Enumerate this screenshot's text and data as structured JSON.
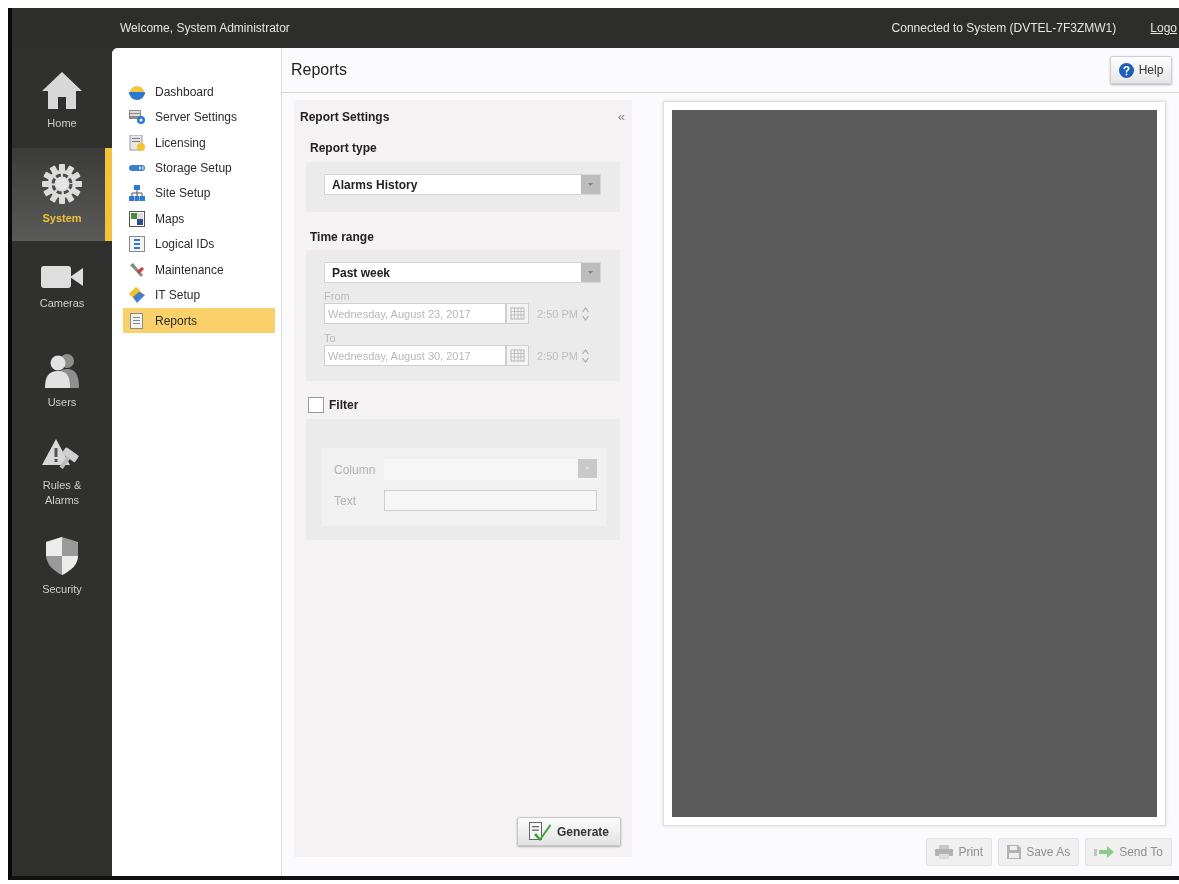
{
  "header": {
    "welcome": "Welcome, System Administrator",
    "connection": "Connected to System (DVTEL-7F3ZMW1)",
    "logout_link": "Logo"
  },
  "nav": [
    {
      "label": "Home",
      "selected": false
    },
    {
      "label": "System",
      "selected": true
    },
    {
      "label": "Cameras",
      "selected": false
    },
    {
      "label": "Users",
      "selected": false
    },
    {
      "label": "Rules & Alarms",
      "selected": false
    },
    {
      "label": "Security",
      "selected": false
    }
  ],
  "sub_nav": [
    {
      "label": "Dashboard",
      "selected": false
    },
    {
      "label": "Server Settings",
      "selected": false
    },
    {
      "label": "Licensing",
      "selected": false
    },
    {
      "label": "Storage Setup",
      "selected": false
    },
    {
      "label": "Site Setup",
      "selected": false
    },
    {
      "label": "Maps",
      "selected": false
    },
    {
      "label": "Logical IDs",
      "selected": false
    },
    {
      "label": "Maintenance",
      "selected": false
    },
    {
      "label": "IT Setup",
      "selected": false
    },
    {
      "label": "Reports",
      "selected": true
    }
  ],
  "page": {
    "title": "Reports",
    "help_button": "Help"
  },
  "report_settings": {
    "title": "Report Settings",
    "collapse": "«",
    "report_type": {
      "label": "Report type",
      "value": "Alarms History"
    },
    "time_range": {
      "label": "Time range",
      "value": "Past week",
      "from": {
        "label": "From",
        "date": "Wednesday, August 23, 2017",
        "time": "2:50 PM",
        "disabled": true
      },
      "to": {
        "label": "To",
        "date": "Wednesday, August 30, 2017",
        "time": "2:50 PM",
        "disabled": true
      }
    },
    "filter": {
      "label": "Filter",
      "checked": false,
      "column_label": "Column",
      "text_label": "Text"
    },
    "generate_button": "Generate"
  },
  "toolbar": [
    {
      "label": "Print",
      "disabled": true
    },
    {
      "label": "Save As",
      "disabled": true
    },
    {
      "label": "Send To",
      "disabled": true
    }
  ]
}
